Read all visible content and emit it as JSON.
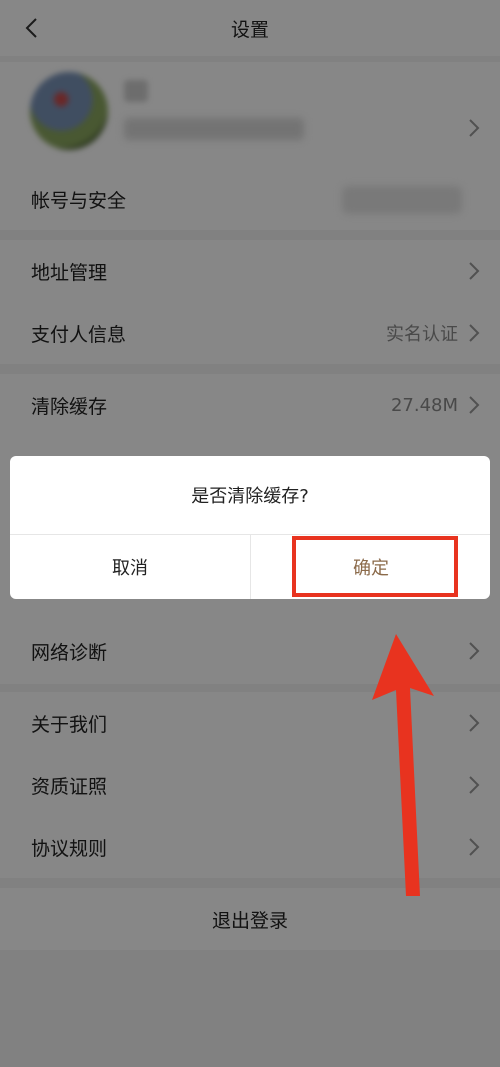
{
  "header": {
    "title": "设置"
  },
  "rows": [
    {
      "label": "帐号与安全",
      "value": ""
    },
    {
      "label": "地址管理",
      "value": ""
    },
    {
      "label": "支付人信息",
      "value": "实名认证"
    },
    {
      "label": "清除缓存",
      "value": "27.48M"
    },
    {
      "label": "网络诊断",
      "value": ""
    },
    {
      "label": "关于我们",
      "value": ""
    },
    {
      "label": "资质证照",
      "value": ""
    },
    {
      "label": "协议规则",
      "value": ""
    }
  ],
  "logout": {
    "label": "退出登录"
  },
  "dialog": {
    "title": "是否清除缓存?",
    "cancel_label": "取消",
    "confirm_label": "确定"
  },
  "colors": {
    "confirm_text": "#8b6a4a",
    "annotation_red": "#e8331f",
    "overlay": "rgba(0,0,0,0.47)"
  },
  "icons": [
    "back-icon",
    "chevron-right-icon"
  ]
}
